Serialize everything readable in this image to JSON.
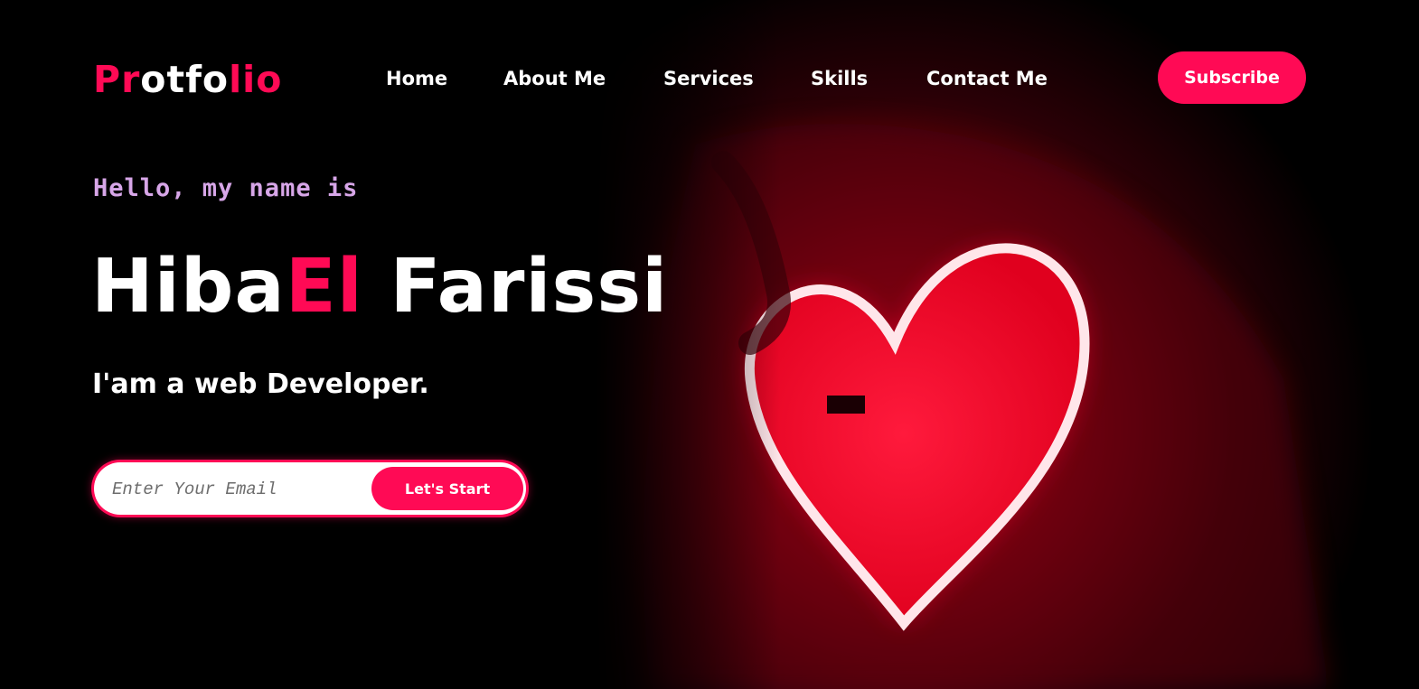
{
  "brand": {
    "logo_parts": [
      "P",
      "r",
      "o",
      "t",
      "f",
      "o",
      "l",
      "i",
      "o"
    ],
    "accent_color": "#ff0a55"
  },
  "nav": {
    "links": [
      "Home",
      "About Me",
      "Services",
      "Skills",
      "Contact Me"
    ],
    "subscribe_label": "Subscribe"
  },
  "hero": {
    "greeting": "Hello, my name is",
    "name_first": "Hiba",
    "name_highlight": "El",
    "name_last": " Farissi",
    "role": "I'am a web Developer.",
    "email_placeholder": "Enter Your Email",
    "cta_label": "Let's Start",
    "greeting_color": "#d7a6e8",
    "background_image": "neon-heart-photo"
  }
}
